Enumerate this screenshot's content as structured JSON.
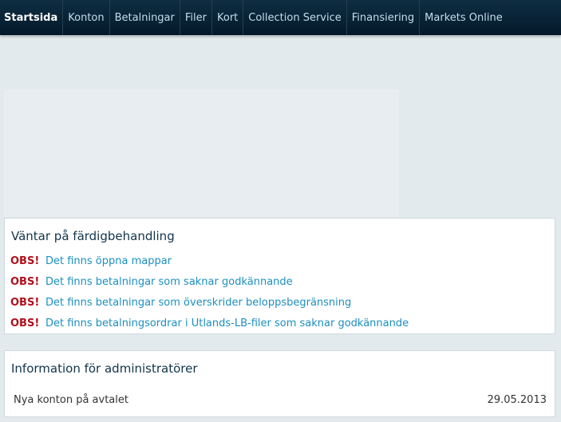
{
  "nav": {
    "items": [
      "Startsida",
      "Konton",
      "Betalningar",
      "Filer",
      "Kort",
      "Collection Service",
      "Finansiering",
      "Markets Online"
    ],
    "active": "Startsida"
  },
  "pending": {
    "title": "Väntar på färdigbehandling",
    "obs_label": "OBS!",
    "items": [
      "Det finns öppna mappar",
      "Det finns betalningar som saknar godkännande",
      "Det finns betalningar som överskrider beloppsbegränsning",
      "Det finns betalningsordrar i Utlands-LB-filer som saknar godkännande"
    ]
  },
  "admin": {
    "title": "Information för administratörer",
    "label": "Nya konton på avtalet",
    "date": "29.05.2013"
  },
  "colors": {
    "nav_bg": "#03192a",
    "obs": "#b0101c",
    "link": "#1b8fc0"
  }
}
